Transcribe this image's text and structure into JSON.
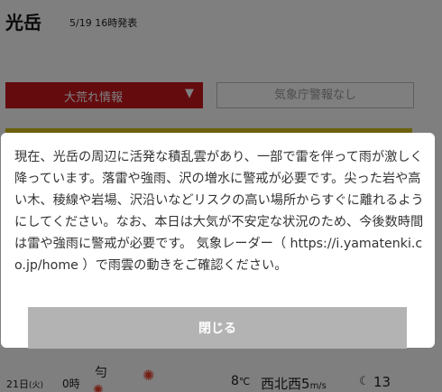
{
  "header": {
    "mountain_name": "光岳",
    "forecast_time": "5/19 16時発表"
  },
  "alerts": {
    "storm_info_label": "大荒れ情報",
    "storm_info_caret": "▼",
    "jma_warning_label": "気象庁警報なし"
  },
  "forecast_row": {
    "date": "21日",
    "weekday": "(火)",
    "hour": "0時",
    "weather_text": "勻",
    "temperature": "8",
    "temperature_unit": "℃",
    "wind_direction": "西北西",
    "wind_speed": "5",
    "wind_unit": "m/s",
    "moon_icon": "crescent-moon-icon",
    "moon_age": "13"
  },
  "modal": {
    "message": "現在、光岳の周辺に活発な積乱雲があり、一部で雷を伴って雨が激しく降っています。落雷や強雨、沢の増水に警戒が必要です。尖った岩や高い木、稜線や岩場、沢沿いなどリスクの高い場所からすぐに離れるようにしてください。なお、本日は大気が不安定な状況のため、今後数時間は雷や強雨に警戒が必要です。 気象レーダー（ https://i.yamatenki.co.jp/home ）で雨雲の動きをご確認ください。",
    "close_label": "閉じる"
  },
  "colors": {
    "storm_red": "#c8161d",
    "strip_yellow": "#d9c21a",
    "button_gray": "#b3b3b3"
  }
}
